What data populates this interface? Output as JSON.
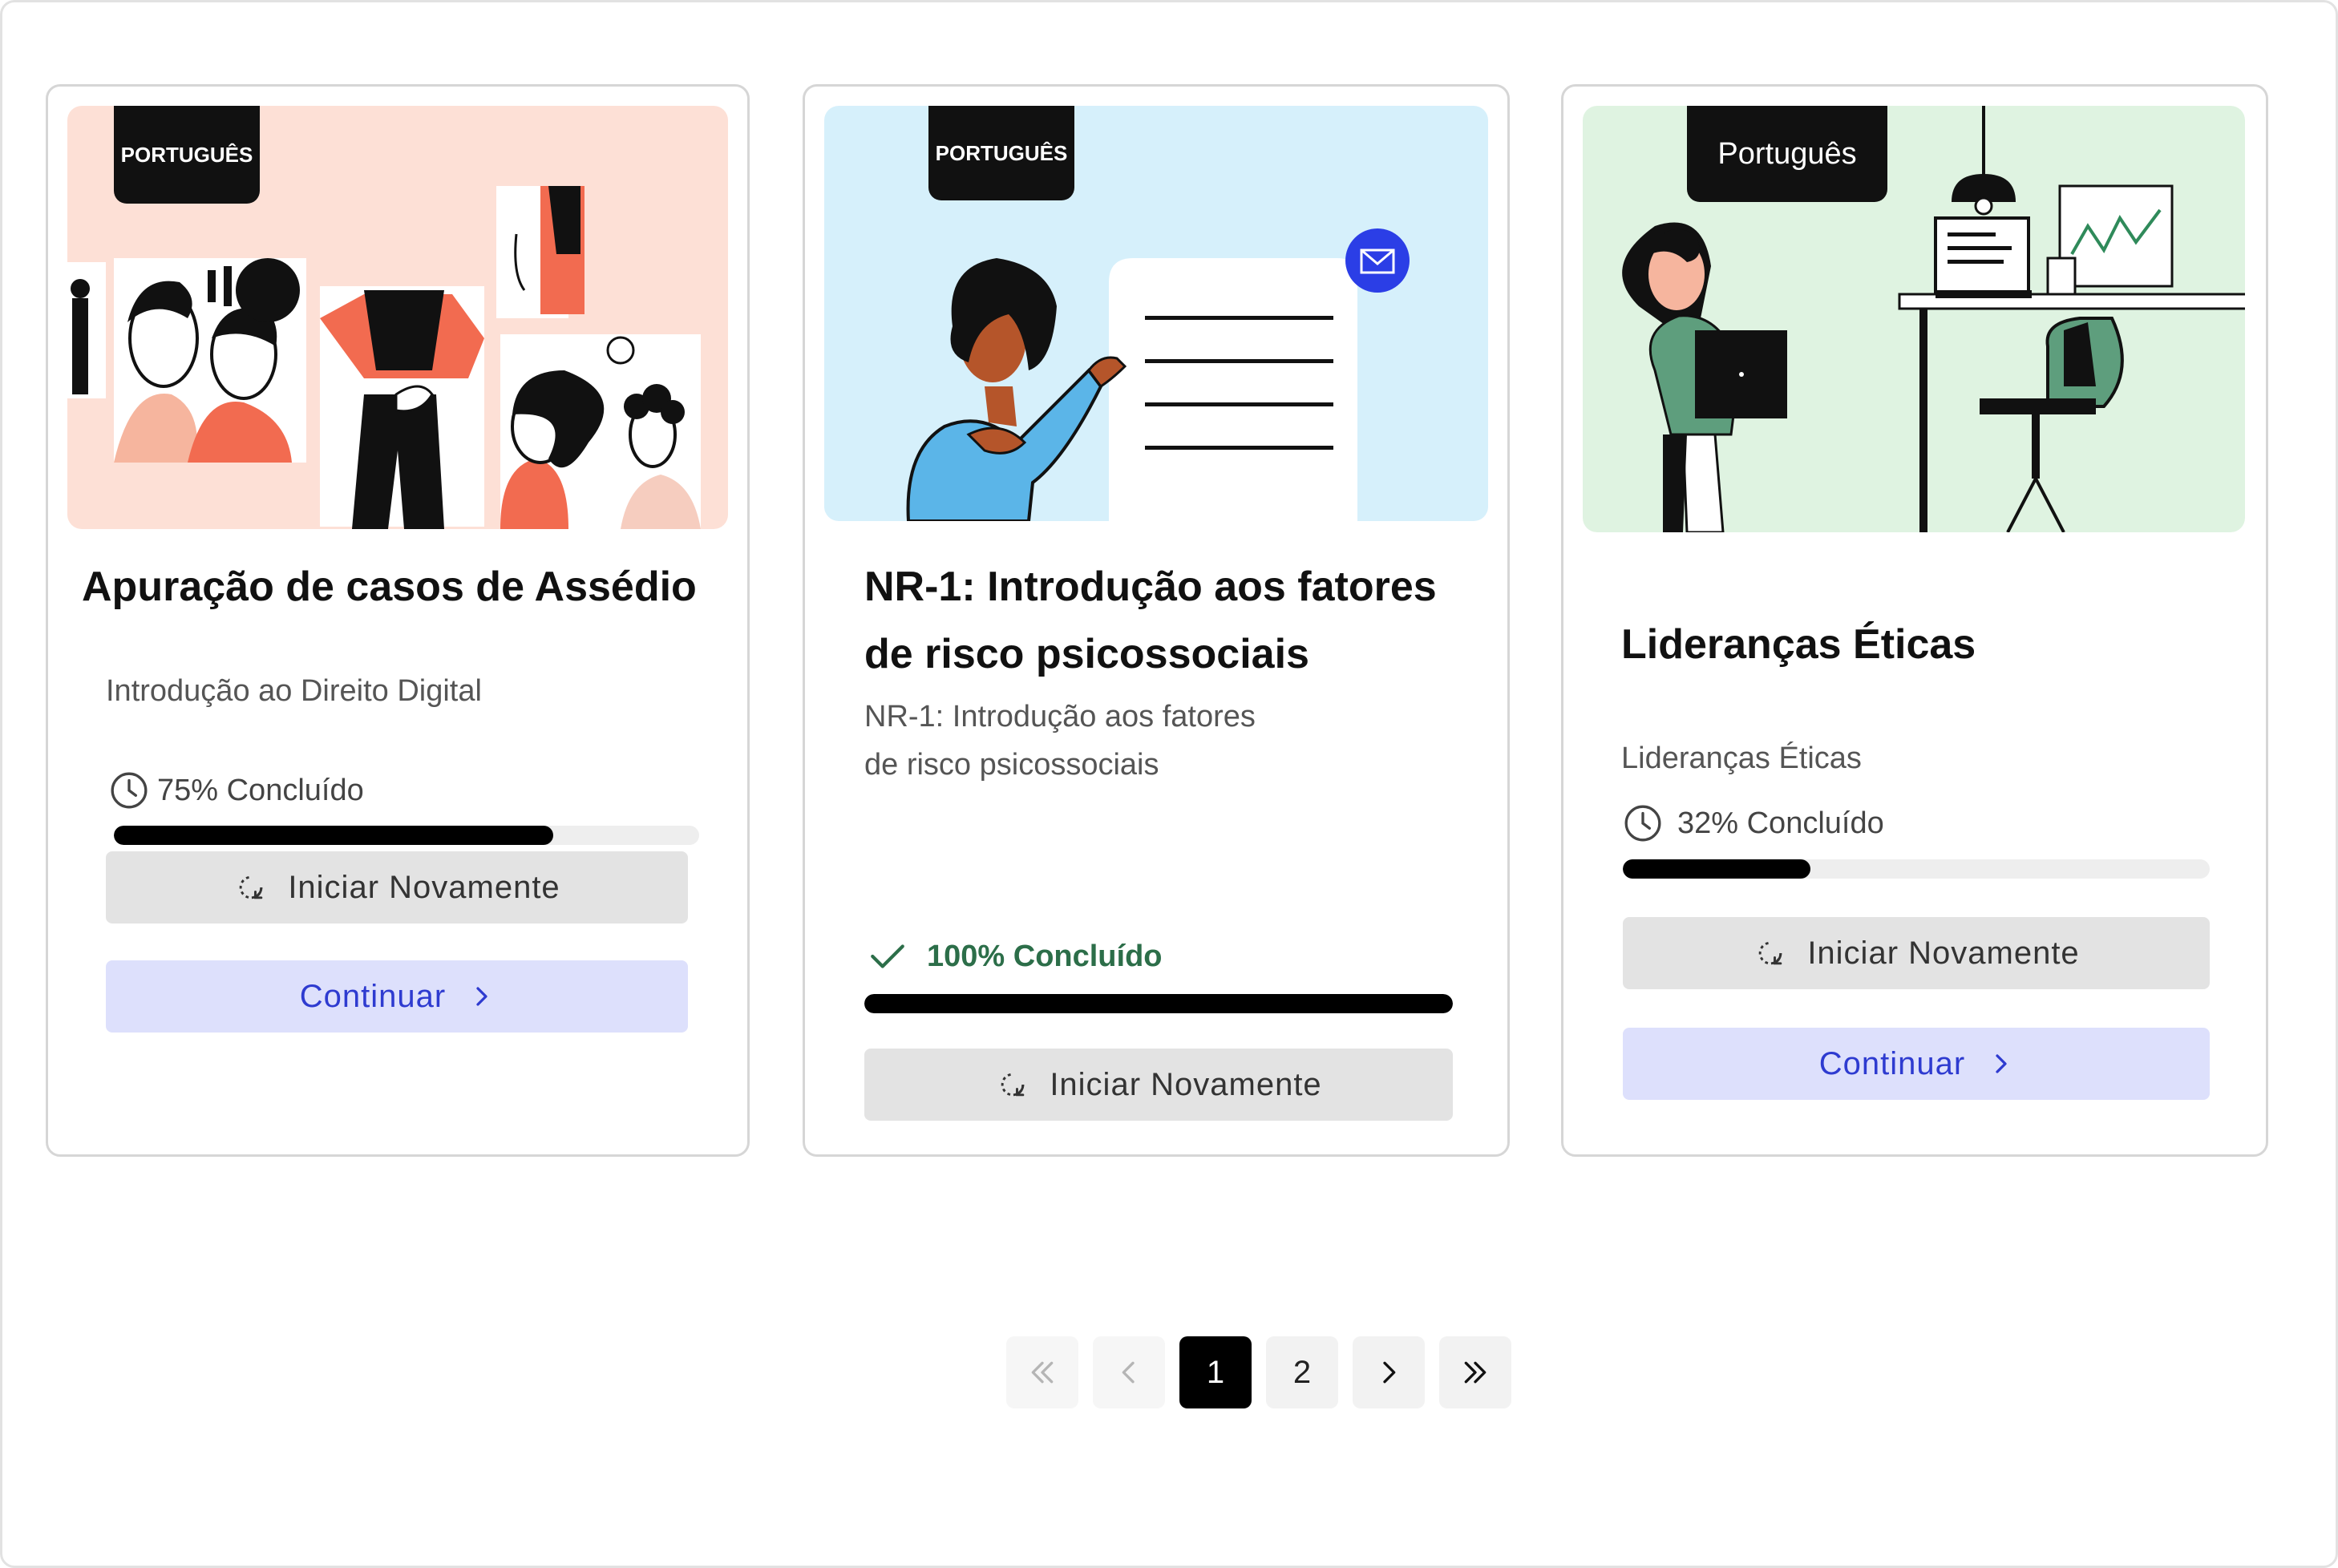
{
  "cards": [
    {
      "language": "PORTUGUÊS",
      "title": "Apuração de casos de Assédio",
      "subtitle": "Introdução ao Direito Digital",
      "progress_text": "75% Concluído",
      "progress": 0.75,
      "restart_label": "Iniciar Novamente",
      "continue_label": "Continuar"
    },
    {
      "language": "PORTUGUÊS",
      "title_line1": "NR-1: Introdução aos fatores",
      "title_line2": "de risco psicossociais",
      "subtitle_line1": "NR-1: Introdução aos fatores",
      "subtitle_line2": "de risco psicossociais",
      "progress_text": "100% Concluído",
      "progress": 1.0,
      "restart_label": "Iniciar Novamente"
    },
    {
      "language": "Português",
      "title": "Lideranças Éticas",
      "subtitle": "Lideranças Éticas",
      "progress_text": "32% Concluído",
      "progress": 0.32,
      "restart_label": "Iniciar Novamente",
      "continue_label": "Continuar"
    }
  ],
  "pagination": {
    "pages": [
      "1",
      "2"
    ],
    "current_page": "1",
    "icons": [
      "double-chevron-left-icon",
      "chevron-left-icon",
      "chevron-right-icon",
      "double-chevron-right-icon"
    ]
  },
  "colors": {
    "completed_green": "#2c6e49",
    "continue_text": "#2e3bd0",
    "continue_bg": "#dde0fc",
    "restart_bg": "#e3e3e3",
    "thumb_pink": "#fde0d6",
    "thumb_blue": "#d6f0fb",
    "thumb_green": "#dff3e1"
  }
}
